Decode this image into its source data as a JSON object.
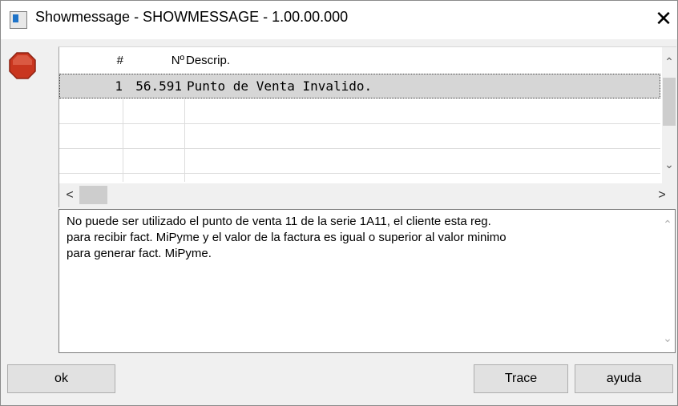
{
  "window": {
    "title": "Showmessage - SHOWMESSAGE - 1.00.00.000",
    "close_glyph": "✕"
  },
  "grid": {
    "columns": [
      "#",
      "Nº",
      "Descrip."
    ],
    "rows": [
      {
        "num": "1",
        "code": "56.591",
        "desc": "Punto de Venta Invalido.",
        "selected": true
      }
    ]
  },
  "message": {
    "lines": [
      "No puede ser utilizado el punto de venta 11 de la serie 1A11, el cliente esta reg.",
      "para recibir fact. MiPyme y el valor de la factura es igual o superior al valor minimo",
      "para generar fact. MiPyme."
    ]
  },
  "buttons": {
    "ok": "ok",
    "trace": "Trace",
    "help": "ayuda"
  },
  "icons": {
    "error": "stop-sign-icon",
    "app": "window-app-icon"
  },
  "colors": {
    "stop_red": "#d9432a",
    "selection": "#d6d6d6"
  }
}
